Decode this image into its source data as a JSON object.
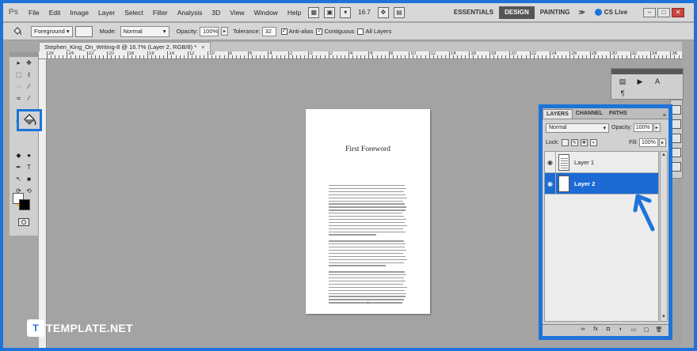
{
  "app": {
    "logo": "Ps",
    "zoom": "16.7"
  },
  "menu": [
    "File",
    "Edit",
    "Image",
    "Layer",
    "Select",
    "Filter",
    "Analysis",
    "3D",
    "View",
    "Window",
    "Help"
  ],
  "workspaces": [
    "ESSENTIALS",
    "DESIGN",
    "PAINTING"
  ],
  "workspace_more": "≫",
  "cs_live": "CS Live",
  "options": {
    "fill_source": "Foreground",
    "mode_label": "Mode:",
    "mode_value": "Normal",
    "opacity_label": "Opacity:",
    "opacity_value": "100%",
    "tolerance_label": "Tolerance:",
    "tolerance_value": "32",
    "antialias": "Anti-alias",
    "contiguous": "Contiguous",
    "all_layers": "All Layers"
  },
  "document": {
    "tab_title": "Stephen_King_On_Writing-8 @ 16.7% (Layer 2, RGB/8) *",
    "page_heading": "First Foreword",
    "page_number": "5"
  },
  "ruler_labels": [
    "26",
    "24",
    "22",
    "20",
    "18",
    "16",
    "14",
    "12",
    "10",
    "8",
    "6",
    "4",
    "2",
    "0",
    "2",
    "4",
    "6",
    "8",
    "10",
    "12",
    "14",
    "16",
    "18",
    "20",
    "22",
    "24",
    "26",
    "28",
    "30",
    "32",
    "34",
    "36"
  ],
  "layers_panel": {
    "tabs": [
      "LAYERS",
      "CHANNEL",
      "PATHS"
    ],
    "blend_mode": "Normal",
    "opacity_label": "Opacity:",
    "opacity_value": "100%",
    "lock_label": "Lock:",
    "fill_label": "Fill:",
    "fill_value": "100%",
    "layers": [
      {
        "name": "Layer 1",
        "selected": false
      },
      {
        "name": "Layer 2",
        "selected": true
      }
    ]
  },
  "watermark": {
    "logo": "T",
    "text": "TEMPLATE.NET"
  },
  "colors": {
    "highlight": "#1e73d9",
    "selected_layer": "#1c6bd4"
  }
}
